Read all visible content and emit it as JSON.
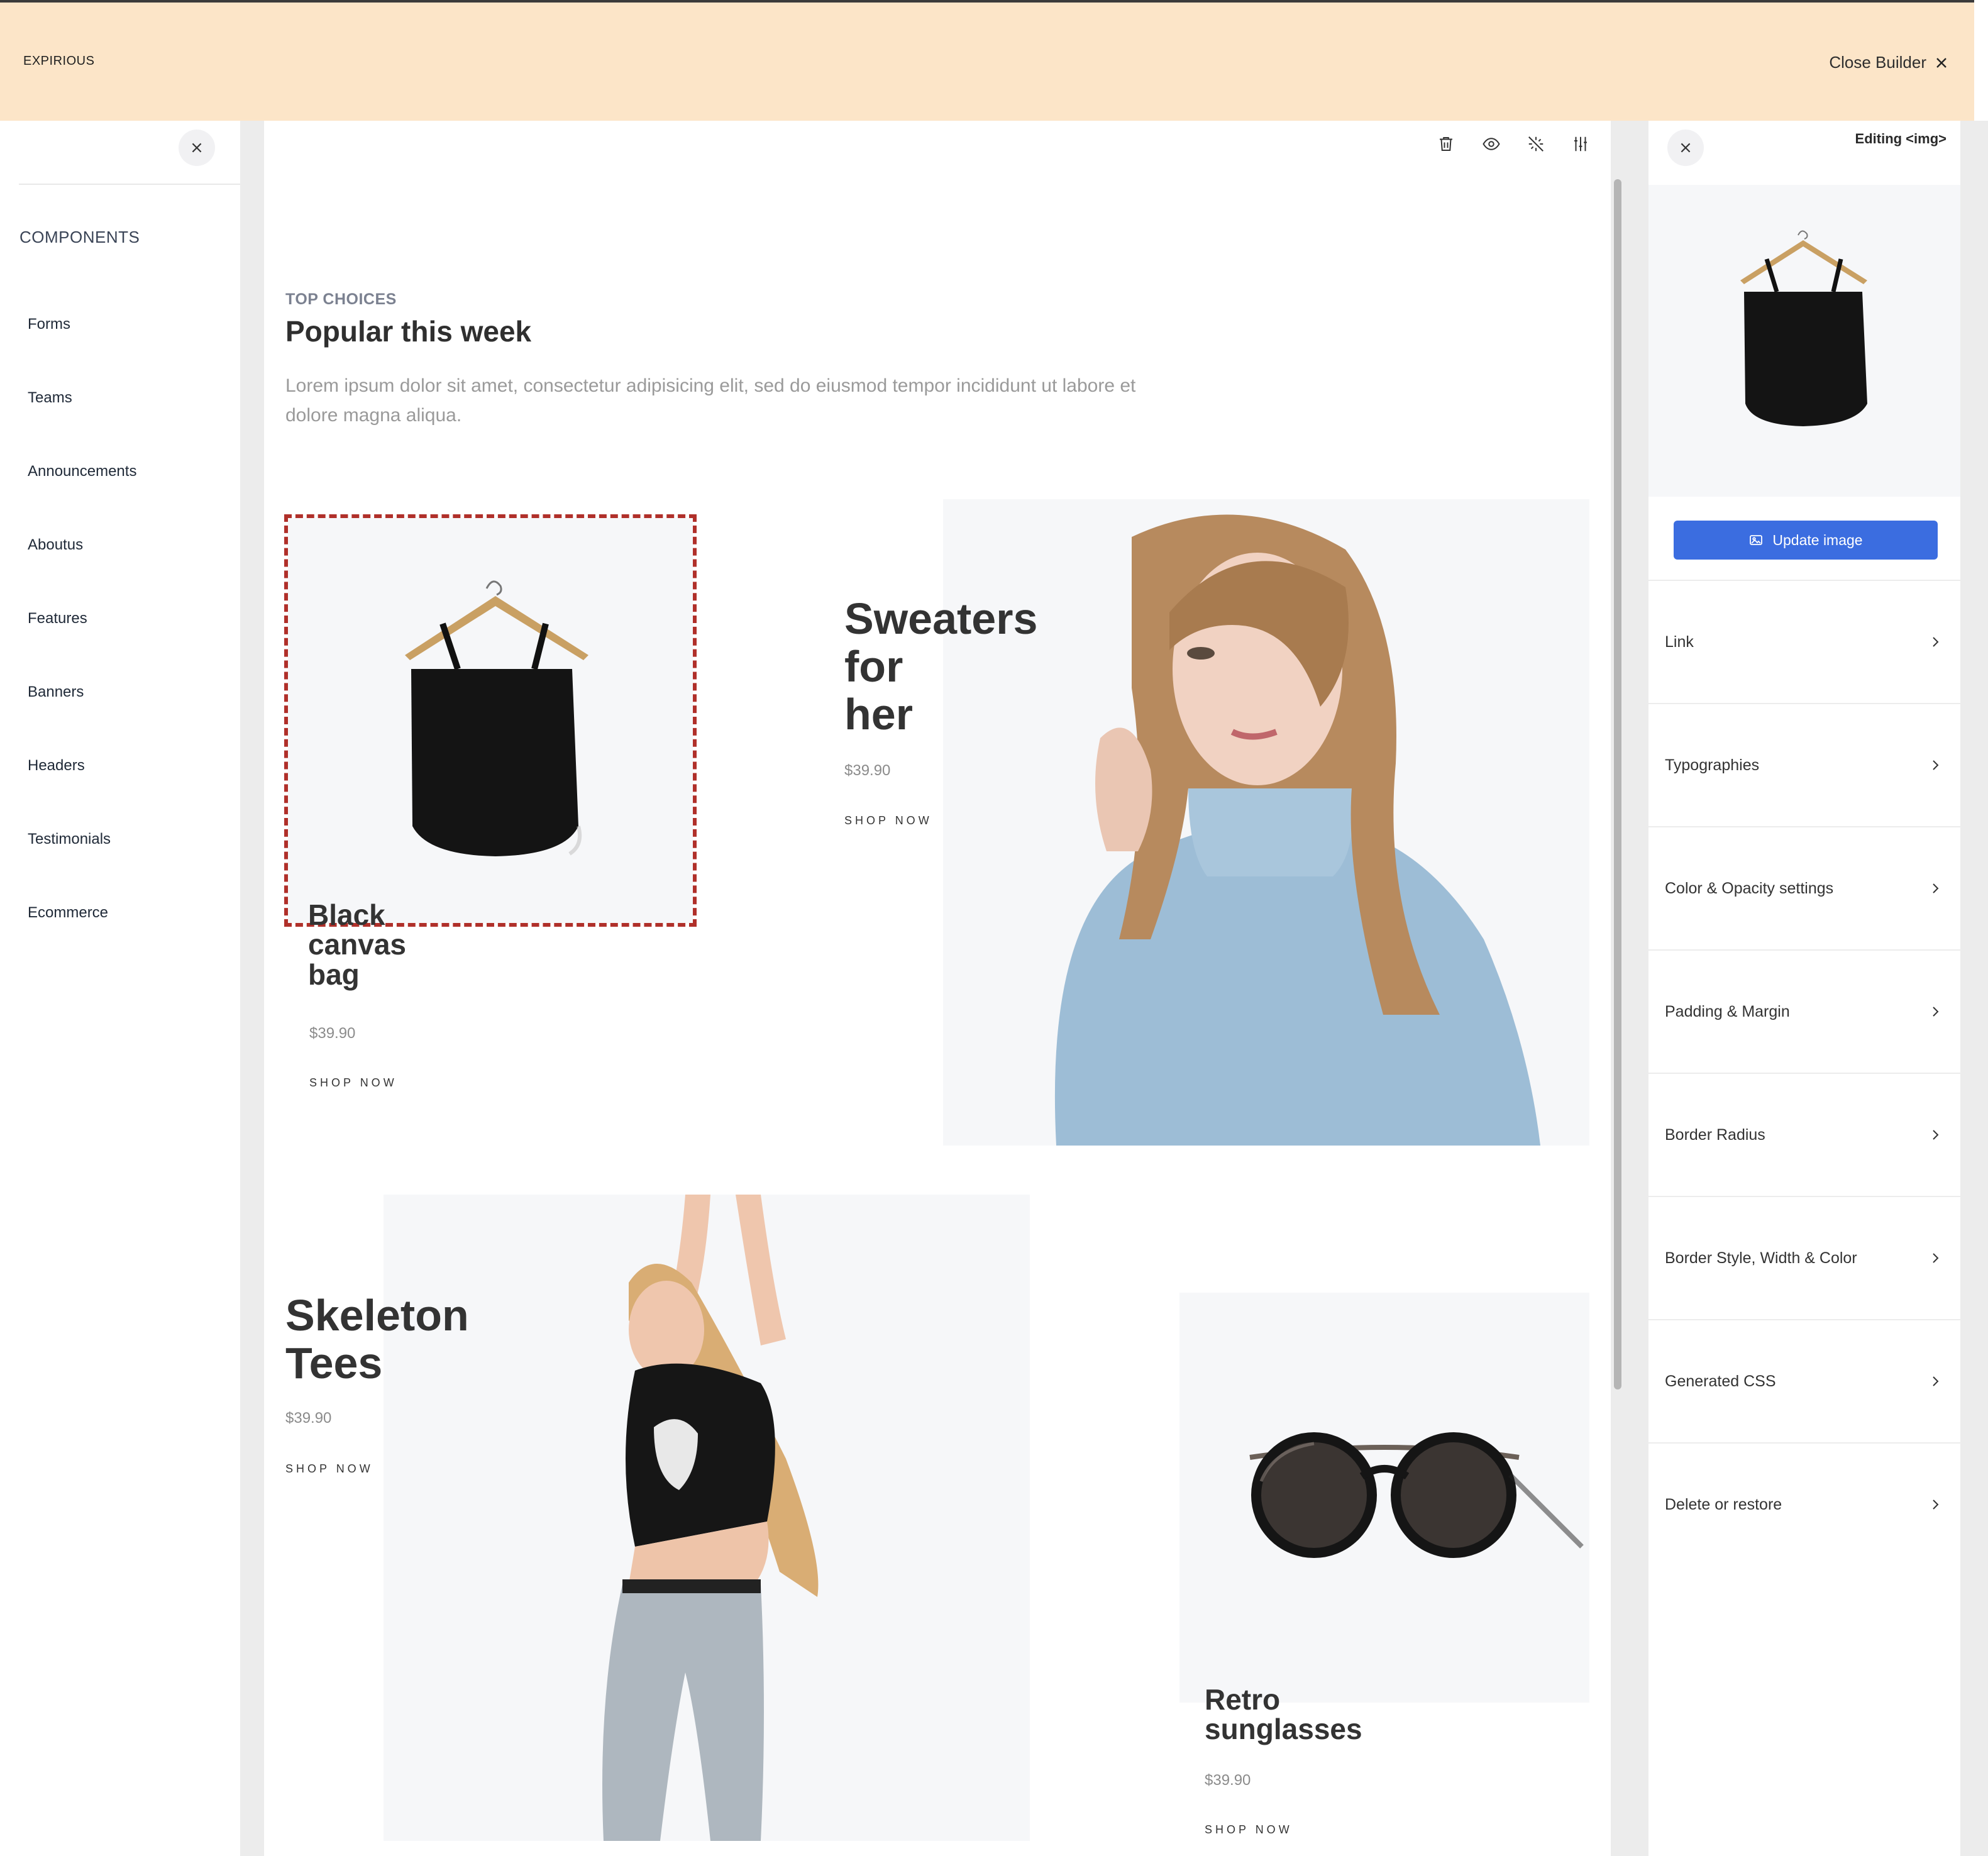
{
  "header": {
    "brand": "EXPIRIOUS",
    "close_label": "Close Builder"
  },
  "sidebar": {
    "title": "COMPONENTS",
    "items": [
      {
        "label": "Forms"
      },
      {
        "label": "Teams"
      },
      {
        "label": "Announcements"
      },
      {
        "label": "Aboutus"
      },
      {
        "label": "Features"
      },
      {
        "label": "Banners"
      },
      {
        "label": "Headers"
      },
      {
        "label": "Testimonials"
      },
      {
        "label": "Ecommerce"
      }
    ]
  },
  "toolbar": {
    "icons": [
      "trash-icon",
      "eye-icon",
      "magic-wand-off-icon",
      "sliders-icon"
    ]
  },
  "section": {
    "eyebrow": "TOP CHOICES",
    "title": "Popular this week",
    "description": "Lorem ipsum dolor sit amet, consectetur adipisicing elit, sed do eiusmod tempor incididunt ut labore et dolore magna aliqua."
  },
  "products": [
    {
      "title_lines": [
        "Black",
        "canvas",
        "bag"
      ],
      "price": "$39.90",
      "cta": "SHOP NOW"
    },
    {
      "title_lines": [
        "Sweaters",
        "for",
        "her"
      ],
      "price": "$39.90",
      "cta": "SHOP NOW"
    },
    {
      "title_lines": [
        "Skeleton",
        "Tees"
      ],
      "price": "$39.90",
      "cta": "SHOP NOW"
    },
    {
      "title_lines": [
        "Retro",
        "sunglasses"
      ],
      "price": "$39.90",
      "cta": "SHOP NOW"
    }
  ],
  "editor": {
    "editing_label": "Editing <img>",
    "update_label": "Update image",
    "settings": [
      {
        "label": "Link"
      },
      {
        "label": "Typographies"
      },
      {
        "label": "Color & Opacity settings"
      },
      {
        "label": "Padding & Margin"
      },
      {
        "label": "Border Radius"
      },
      {
        "label": "Border Style, Width & Color"
      },
      {
        "label": "Generated CSS"
      },
      {
        "label": "Delete or restore"
      }
    ]
  },
  "colors": {
    "topbar": "#fce5c8",
    "accent": "#3b6de0",
    "selection": "#b0302a"
  }
}
